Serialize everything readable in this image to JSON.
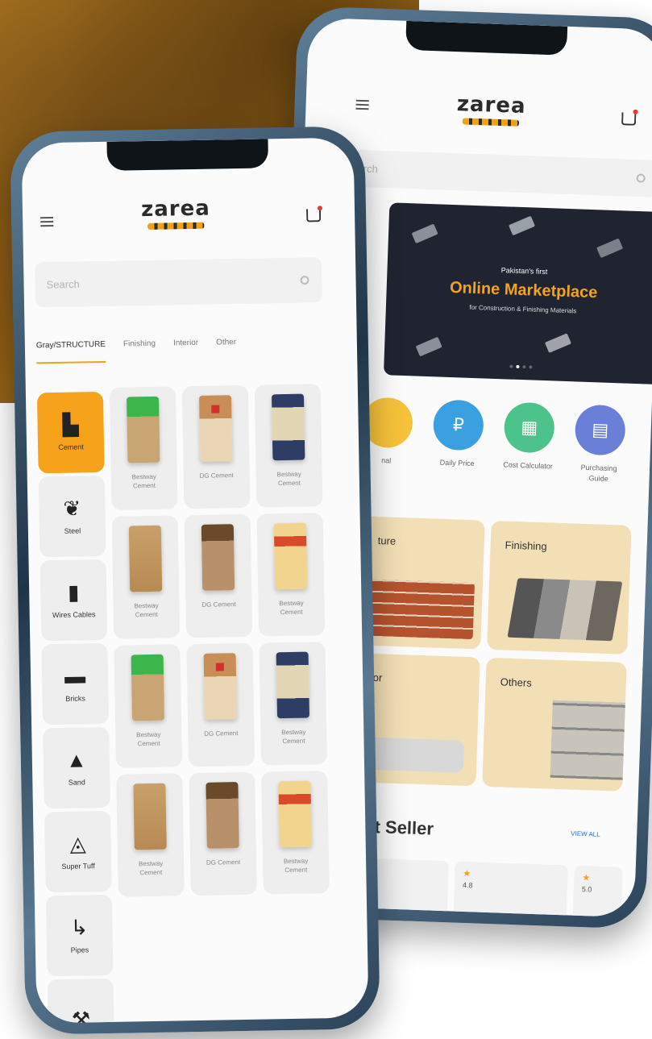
{
  "brand": {
    "logo_text": "zarea"
  },
  "front": {
    "search_placeholder": "Search",
    "tabs": [
      {
        "label": "Gray/STRUCTURE"
      },
      {
        "label": "Finishing"
      },
      {
        "label": "Interior"
      },
      {
        "label": "Other"
      }
    ],
    "categories": [
      {
        "label": "Cement",
        "glyph": "▙"
      },
      {
        "label": "Steel",
        "glyph": "❦"
      },
      {
        "label": "Wires Cables",
        "glyph": "▮"
      },
      {
        "label": "Bricks",
        "glyph": "▬"
      },
      {
        "label": "Sand",
        "glyph": "▲"
      },
      {
        "label": "Super Tuff",
        "glyph": "◬"
      },
      {
        "label": "Pipes",
        "glyph": "↳"
      },
      {
        "label": "",
        "glyph": "⚒"
      }
    ],
    "products": [
      {
        "name": "Bestway Cement"
      },
      {
        "name": "DG Cement"
      },
      {
        "name": "Bestway Cement"
      },
      {
        "name": "Bestway Cement"
      },
      {
        "name": "DG Cement"
      },
      {
        "name": "Bestway Cement"
      },
      {
        "name": "Bestway Cement"
      },
      {
        "name": "DG Cement"
      },
      {
        "name": "Bestway Cement"
      },
      {
        "name": "Bestway Cement"
      },
      {
        "name": "DG Cement"
      },
      {
        "name": "Bestway Cement"
      }
    ]
  },
  "back": {
    "search_placeholder": "rch",
    "banner": {
      "small": "Pakistan's first",
      "big": "Online Marketplace",
      "sub": "for Construction & Finishing Materials"
    },
    "services": [
      {
        "label": "nal",
        "glyph": "",
        "color": "#f6c23a"
      },
      {
        "label": "Daily Price",
        "glyph": "₽",
        "color": "#3aa0e0"
      },
      {
        "label": "Cost Calculator",
        "glyph": "▦",
        "color": "#4cc38a"
      },
      {
        "label": "Purchasing Guide",
        "glyph": "▤",
        "color": "#6a7fd8"
      }
    ],
    "tiles": [
      {
        "label": "ture"
      },
      {
        "label": "Finishing"
      },
      {
        "label": "or"
      },
      {
        "label": "Others"
      }
    ],
    "best_seller": {
      "title": "st Seller",
      "view_all": "VIEW ALL"
    },
    "ratings": [
      {
        "value": "4.8"
      },
      {
        "value": "5.0"
      }
    ]
  }
}
